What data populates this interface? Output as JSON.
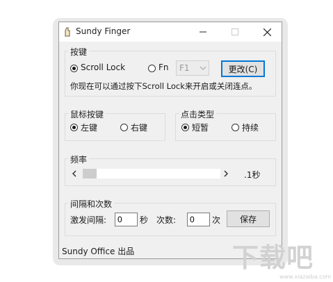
{
  "window": {
    "title": "Sundy Finger",
    "icon": "finger-icon",
    "controls": {
      "minimize": "minimize-icon",
      "maximize": "maximize-icon",
      "close": "close-icon"
    }
  },
  "hotkey": {
    "legend": "按键",
    "scroll_lock_label": "Scroll Lock",
    "fn_label": "Fn",
    "fn_value": "F1",
    "change_button": "更改(C)",
    "hint": "你现在可以通过按下Scroll Lock来开启或关闭连点。",
    "selected": "Scroll Lock"
  },
  "mouse": {
    "legend": "鼠标按键",
    "left_label": "左键",
    "right_label": "右键",
    "selected": "左键"
  },
  "click_type": {
    "legend": "点击类型",
    "short_label": "短暂",
    "hold_label": "持续",
    "selected": "短暂"
  },
  "frequency": {
    "legend": "频率",
    "value_text": ".1秒",
    "slider_position": 0
  },
  "interval": {
    "legend": "间隔和次数",
    "trigger_label": "激发间隔:",
    "trigger_value": "0",
    "trigger_unit": "秒",
    "count_label": "次数:",
    "count_value": "0",
    "count_unit": "次",
    "save_button": "保存"
  },
  "status": {
    "text": "Sundy Office 出品"
  },
  "watermark": {
    "text": "下载吧",
    "url": "www.xiazaiba.com"
  },
  "colors": {
    "accent": "#0078d7",
    "window_bg": "#f0f0f0"
  }
}
